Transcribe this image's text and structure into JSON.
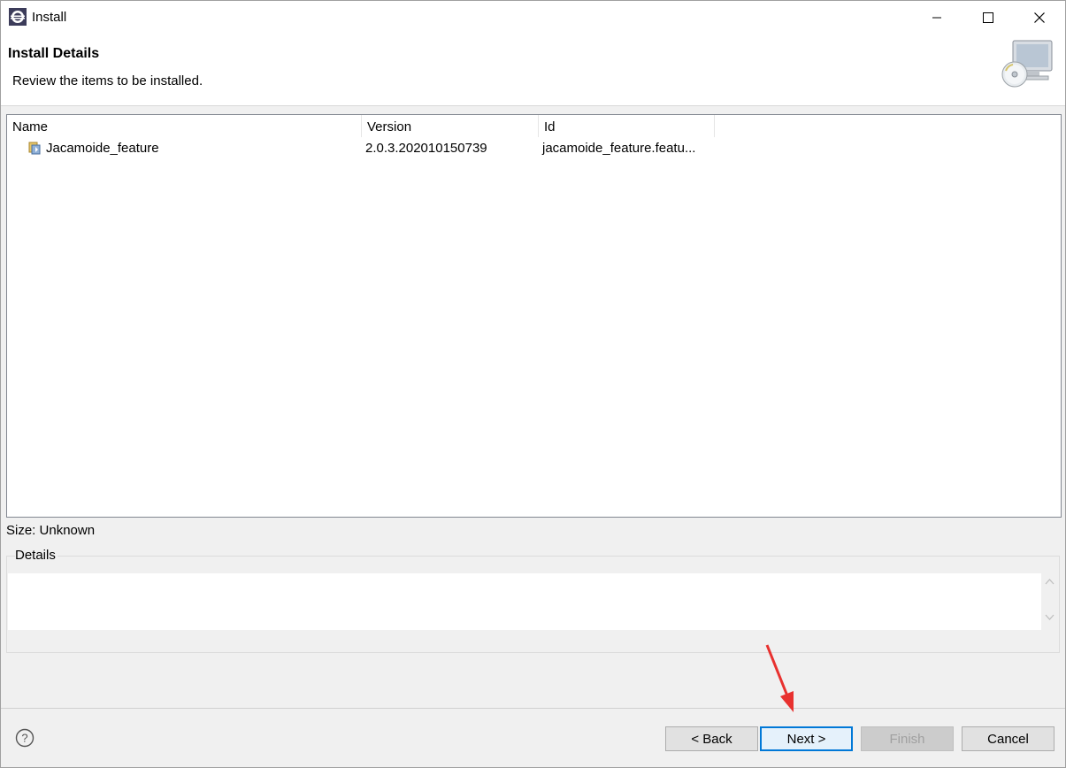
{
  "window": {
    "title": "Install",
    "controls": {
      "minimize": "minimize",
      "maximize": "maximize",
      "close": "close"
    }
  },
  "header": {
    "title": "Install Details",
    "description": "Review the items to be installed.",
    "icon": "install-cd-computer-icon"
  },
  "table": {
    "columns": [
      "Name",
      "Version",
      "Id"
    ],
    "rows": [
      {
        "name": "Jacamoide_feature",
        "version": "2.0.3.202010150739",
        "id": "jacamoide_feature.featu...",
        "icon": "feature-icon"
      }
    ]
  },
  "size_label": "Size: Unknown",
  "details": {
    "legend": "Details",
    "text": ""
  },
  "footer": {
    "help_icon": "help-icon",
    "back_label": "< Back",
    "next_label": "Next >",
    "finish_label": "Finish",
    "cancel_label": "Cancel"
  },
  "colors": {
    "accent": "#0078d7",
    "annotation_arrow": "#e8312f"
  }
}
